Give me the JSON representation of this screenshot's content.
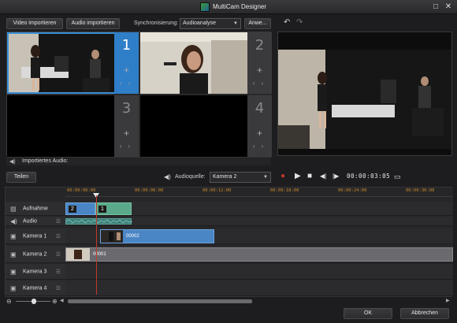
{
  "window": {
    "title": "MultiCam Designer",
    "buttons": [
      "□",
      "✕"
    ]
  },
  "toolbar": {
    "video_import": "Video importieren",
    "audio_import": "Audio importieren",
    "sync_label": "Synchronisierung:",
    "sync_value": "Audioanalyse",
    "apply": "Anwe..."
  },
  "cameras": [
    {
      "number": "1",
      "selected": true
    },
    {
      "number": "2",
      "selected": false
    },
    {
      "number": "3",
      "selected": false
    },
    {
      "number": "4",
      "selected": false
    }
  ],
  "audio_strip": {
    "label": "Importiertes Audio:"
  },
  "split_button": "Teilen",
  "audio_source": {
    "label": "Audioquelle:",
    "value": "Kamera 2"
  },
  "transport": {
    "timecode": "00:00:03:05"
  },
  "ruler_ticks": [
    "00:00:00:00",
    "00:00:06:00",
    "00:00:12:00",
    "00:00:18:00",
    "00:00:24:00",
    "00:00:30:00"
  ],
  "tracks": [
    {
      "name": "Aufnahme",
      "icon": "recording-icon"
    },
    {
      "name": "Audio",
      "icon": "speaker-icon"
    },
    {
      "name": "Kamera 1",
      "icon": "camera-icon"
    },
    {
      "name": "Kamera 2",
      "icon": "camera-icon"
    },
    {
      "name": "Kamera 3",
      "icon": "camera-icon"
    },
    {
      "name": "Kamera 4",
      "icon": "camera-icon"
    }
  ],
  "clips": {
    "rec_a": "2",
    "rec_b": "1",
    "cam1": "00002",
    "cam2": "00001"
  },
  "footer": {
    "ok": "OK",
    "cancel": "Abbrechen"
  },
  "colors": {
    "accent": "#2f7ec8",
    "playhead": "#c0392b",
    "ruler_text": "#c88a2a",
    "clip_blue": "#4a86c5",
    "clip_green": "#5aa98a"
  }
}
